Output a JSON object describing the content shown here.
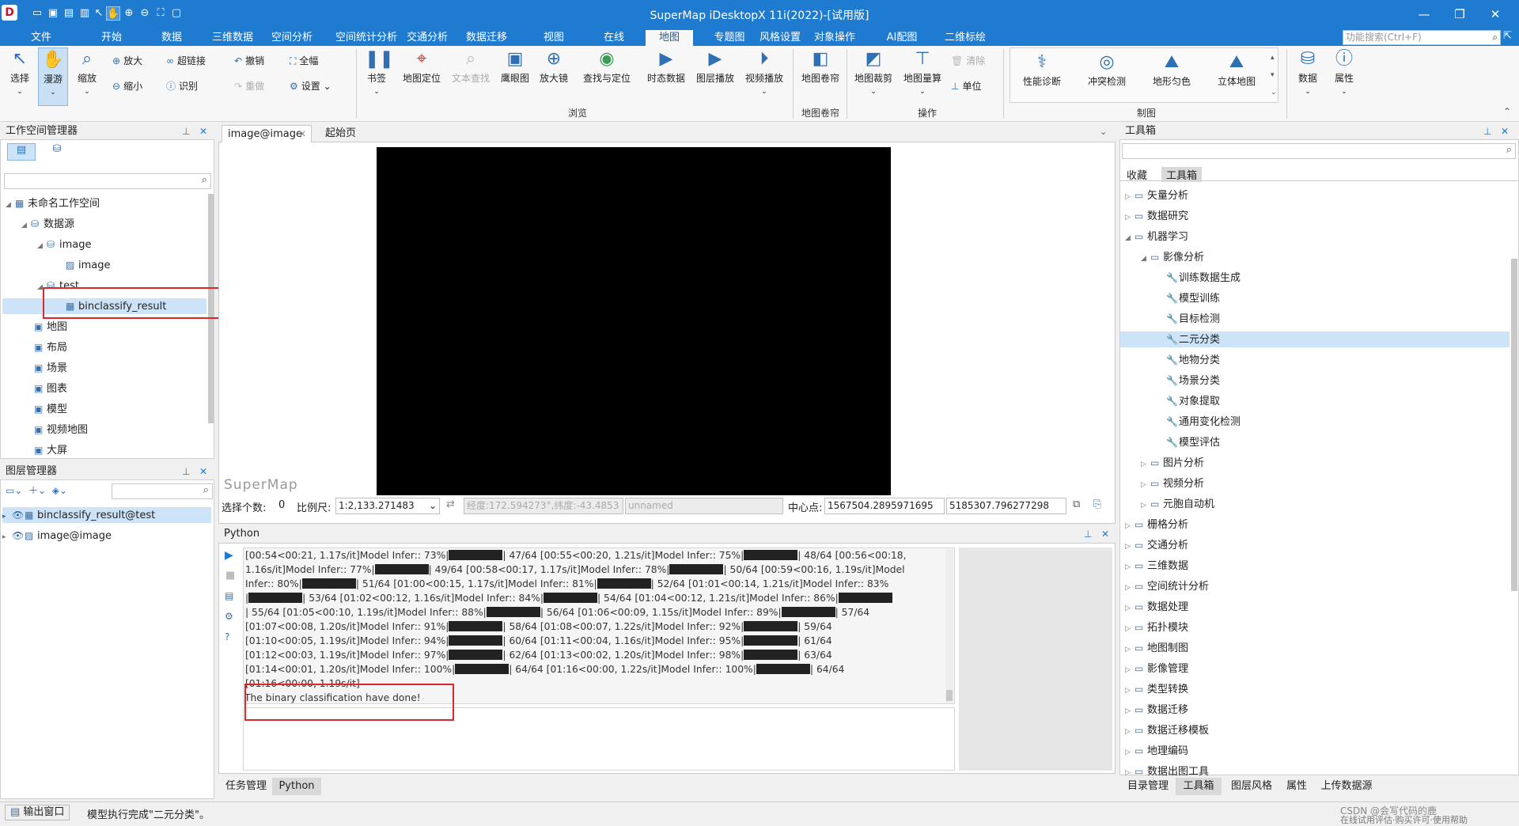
{
  "app": {
    "title": "SuperMap iDesktopX 11i(2022)-[试用版]",
    "logo": "D"
  },
  "menu": {
    "tabs": [
      "文件",
      "开始",
      "数据",
      "三维数据",
      "空间分析",
      "空间统计分析",
      "交通分析",
      "数据迁移",
      "视图",
      "在线",
      "地图",
      "专题图",
      "风格设置",
      "对象操作",
      "AI配图",
      "二维标绘"
    ],
    "active_index": 10,
    "search_placeholder": "功能搜索(Ctrl+F)"
  },
  "ribbon": {
    "select": "选择",
    "pan": "漫游",
    "zoom": "缩放",
    "zoom_in": "放大",
    "zoom_out": "缩小",
    "hyperlink": "超链接",
    "identify": "识别",
    "undo": "撤销",
    "redo": "重做",
    "full": "全幅",
    "settings": "设置",
    "bookmark": "书签",
    "locate": "地图定位",
    "text_search": "文本查找",
    "eagle": "鹰眼图",
    "magnifier": "放大镜",
    "find_locate": "查找与定位",
    "temporal": "时态数据",
    "layer_play": "图层播放",
    "video_play": "视频播放",
    "swipe": "地图卷帘",
    "clip": "地图裁剪",
    "measure": "地图量算",
    "clear": "清除",
    "unit": "单位",
    "perf": "性能诊断",
    "conflict": "冲突检测",
    "terrain": "地形匀色",
    "stereo": "立体地图",
    "data": "数据",
    "property": "属性",
    "groups": {
      "browse": "浏览",
      "swipe": "地图卷帘",
      "operate": "操作",
      "carto": "制图"
    }
  },
  "workspace": {
    "title": "工作空间管理器",
    "root": "未命名工作空间",
    "datasources": "数据源",
    "ds_image": "image",
    "dt_image": "image",
    "ds_test": "test",
    "dt_result": "binclassify_result",
    "maps": "地图",
    "layouts": "布局",
    "scenes": "场景",
    "charts": "图表",
    "models": "模型",
    "videomaps": "视频地图",
    "screens": "大屏"
  },
  "layers": {
    "title": "图层管理器",
    "items": [
      "binclassify_result@test",
      "image@image"
    ]
  },
  "doc": {
    "tabs": [
      "image@image",
      "起始页"
    ],
    "watermark": "SuperMap"
  },
  "mapstatus": {
    "sel_label": "选择个数:",
    "sel_count": "0",
    "scale_label": "比例尺:",
    "scale": "1:2,133.271483",
    "coord": "经度:172.594273°,纬度:-43.4853",
    "name": "unnamed",
    "center_label": "中心点:",
    "cx": "1567504.2895971695",
    "cy": "5185307.796277298"
  },
  "python": {
    "title": "Python",
    "lines": [
      [
        [
          "[00:54<00:21,  1.17s/it]Model Infer:: 73%|",
          "b",
          "| 47/64 [00:55<00:20,  1.21s/it]Model Infer:: 75%|",
          "b",
          "| 48/64 [00:56<00:18,"
        ]
      ],
      [
        [
          "1.16s/it]Model Infer:: 77%|",
          "b",
          "| 49/64 [00:58<00:17,  1.17s/it]Model Infer:: 78%|",
          "b",
          "| 50/64 [00:59<00:16,  1.19s/it]Model"
        ]
      ],
      [
        [
          "Infer:: 80%|",
          "b",
          "| 51/64 [01:00<00:15,  1.17s/it]Model Infer:: 81%|",
          "b",
          "| 52/64 [01:01<00:14,  1.21s/it]Model Infer:: 83%"
        ]
      ],
      [
        [
          "|",
          "b",
          "| 53/64 [01:02<00:12,  1.16s/it]Model Infer:: 84%|",
          "b",
          "| 54/64 [01:04<00:12,  1.21s/it]Model Infer:: 86%|",
          "b"
        ]
      ],
      [
        [
          "| 55/64 [01:05<00:10,  1.19s/it]Model Infer:: 88%|",
          "b",
          "| 56/64 [01:06<00:09,  1.15s/it]Model Infer:: 89%|",
          "b",
          "| 57/64"
        ]
      ],
      [
        [
          "[01:07<00:08,  1.20s/it]Model Infer:: 91%|",
          "b",
          "| 58/64 [01:08<00:07,  1.22s/it]Model Infer:: 92%|",
          "b",
          "| 59/64"
        ]
      ],
      [
        [
          "[01:10<00:05,  1.19s/it]Model Infer:: 94%|",
          "b",
          "| 60/64 [01:11<00:04,  1.16s/it]Model Infer:: 95%|",
          "b",
          "| 61/64"
        ]
      ],
      [
        [
          "[01:12<00:03,  1.19s/it]Model Infer:: 97%|",
          "b",
          "| 62/64 [01:13<00:02,  1.20s/it]Model Infer:: 98%|",
          "b",
          "| 63/64"
        ]
      ],
      [
        [
          "[01:14<00:01,  1.20s/it]Model Infer:: 100%|",
          "b",
          "| 64/64 [01:16<00:00,  1.22s/it]Model Infer:: 100%|",
          "b",
          "| 64/64"
        ]
      ],
      [
        [
          "[01:16<00:00,  1.19s/it]"
        ]
      ]
    ],
    "done": "The binary classification have done!"
  },
  "bottomtabs": [
    "任务管理",
    "Python"
  ],
  "toolbox": {
    "title": "工具箱",
    "tabs": [
      "收藏",
      "工具箱"
    ],
    "items": [
      {
        "label": "矢量分析",
        "level": 0,
        "exp": "closed"
      },
      {
        "label": "数据研究",
        "level": 0,
        "exp": "closed"
      },
      {
        "label": "机器学习",
        "level": 0,
        "exp": "open"
      },
      {
        "label": "影像分析",
        "level": 1,
        "exp": "open"
      },
      {
        "label": "训练数据生成",
        "level": 2,
        "exp": ""
      },
      {
        "label": "模型训练",
        "level": 2,
        "exp": ""
      },
      {
        "label": "目标检测",
        "level": 2,
        "exp": ""
      },
      {
        "label": "二元分类",
        "level": 2,
        "exp": "",
        "sel": true
      },
      {
        "label": "地物分类",
        "level": 2,
        "exp": ""
      },
      {
        "label": "场景分类",
        "level": 2,
        "exp": ""
      },
      {
        "label": "对象提取",
        "level": 2,
        "exp": ""
      },
      {
        "label": "通用变化检测",
        "level": 2,
        "exp": ""
      },
      {
        "label": "模型评估",
        "level": 2,
        "exp": ""
      },
      {
        "label": "图片分析",
        "level": 1,
        "exp": "closed"
      },
      {
        "label": "视频分析",
        "level": 1,
        "exp": "closed"
      },
      {
        "label": "元胞自动机",
        "level": 1,
        "exp": "closed"
      },
      {
        "label": "栅格分析",
        "level": 0,
        "exp": "closed"
      },
      {
        "label": "交通分析",
        "level": 0,
        "exp": "closed"
      },
      {
        "label": "三维数据",
        "level": 0,
        "exp": "closed"
      },
      {
        "label": "空间统计分析",
        "level": 0,
        "exp": "closed"
      },
      {
        "label": "数据处理",
        "level": 0,
        "exp": "closed"
      },
      {
        "label": "拓扑模块",
        "level": 0,
        "exp": "closed"
      },
      {
        "label": "地图制图",
        "level": 0,
        "exp": "closed"
      },
      {
        "label": "影像管理",
        "level": 0,
        "exp": "closed"
      },
      {
        "label": "类型转换",
        "level": 0,
        "exp": "closed"
      },
      {
        "label": "数据迁移",
        "level": 0,
        "exp": "closed"
      },
      {
        "label": "数据迁移模板",
        "level": 0,
        "exp": "closed"
      },
      {
        "label": "地理编码",
        "level": 0,
        "exp": "closed"
      },
      {
        "label": "数据出图工具",
        "level": 0,
        "exp": "closed"
      }
    ],
    "bottom_tabs": [
      "目录管理",
      "工具箱",
      "图层风格",
      "属性",
      "上传数据源"
    ]
  },
  "status": {
    "output": "输出窗口",
    "message": "模型执行完成\"二元分类\"。",
    "watermark": "CSDN @会写代码的鹿",
    "trial": "在线试用评估·购买许可·使用帮助"
  }
}
